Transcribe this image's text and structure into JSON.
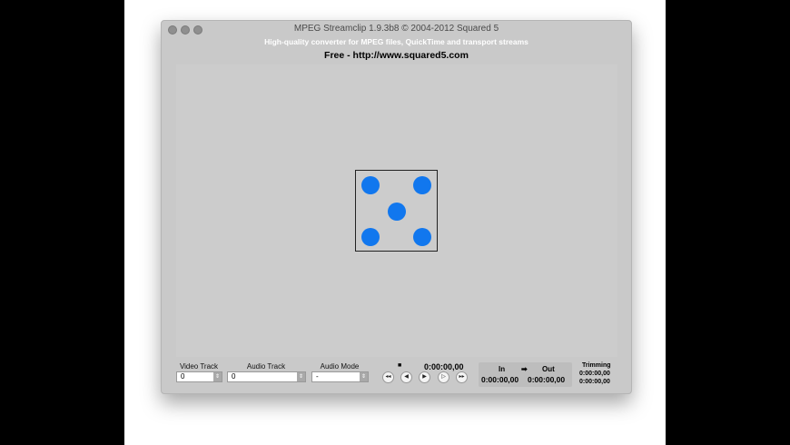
{
  "window": {
    "title": "MPEG Streamclip 1.9.3b8  ©  2004-2012 Squared 5",
    "subtitle": "High-quality converter for MPEG files, QuickTime and transport streams",
    "free_line": "Free  -  http://www.squared5.com"
  },
  "controls": {
    "video_track": {
      "label": "Video Track",
      "value": "0"
    },
    "audio_track": {
      "label": "Audio Track",
      "value": "0"
    },
    "audio_mode": {
      "label": "Audio Mode",
      "value": "-"
    },
    "stop_glyph": "■",
    "current_time": "0:00:00,00",
    "transport": {
      "rewind": "◂◂",
      "step_back": "◀",
      "play": "▶",
      "step_forward": "▷",
      "fast_forward": "▸▸"
    },
    "in_label": "In",
    "arrow_label": "➡",
    "out_label": "Out",
    "in_time": "0:00:00,00",
    "out_time": "0:00:00,00",
    "trimming_label": "Trimming",
    "trim_start": "0:00:00,00",
    "trim_end": "0:00:00,00"
  },
  "colors": {
    "dot": "#1177ee",
    "window_bg": "#c9c9c9"
  }
}
